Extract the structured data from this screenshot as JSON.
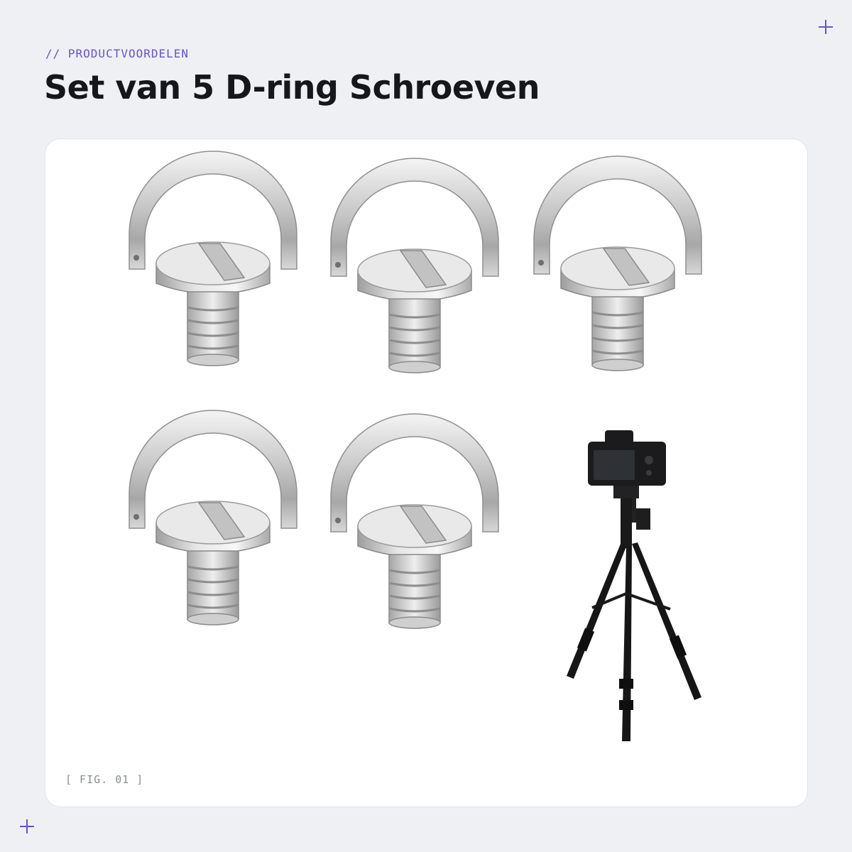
{
  "header": {
    "eyebrow": "// PRODUCTVOORDELEN",
    "title": "Set van 5 D-ring Schroeven"
  },
  "figure": {
    "label": "[ FIG. 01 ]",
    "items": [
      "d-ring-screw",
      "d-ring-screw",
      "d-ring-screw",
      "d-ring-screw",
      "d-ring-screw",
      "camera-on-tripod"
    ]
  },
  "colors": {
    "accent": "#6b4fd8",
    "background": "#eef0f4",
    "card": "#ffffff",
    "title": "#15171c"
  }
}
